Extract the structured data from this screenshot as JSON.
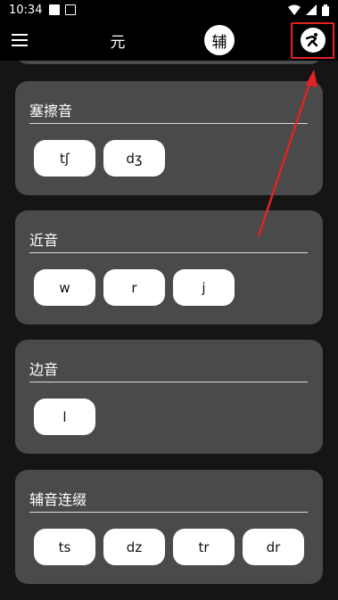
{
  "status": {
    "time": "10:34"
  },
  "toolbar": {
    "tab_vowel": "元",
    "tab_consonant": "辅"
  },
  "sections": [
    {
      "title": "塞擦音",
      "items": [
        "tʃ",
        "dʒ"
      ]
    },
    {
      "title": "近音",
      "items": [
        "w",
        "r",
        "j"
      ]
    },
    {
      "title": "边音",
      "items": [
        "l"
      ]
    },
    {
      "title": "辅音连缀",
      "items": [
        "ts",
        "dz",
        "tr",
        "dr"
      ]
    }
  ],
  "colors": {
    "background": "#151515",
    "card": "#4a4a4c",
    "chip": "#ffffff",
    "highlight": "#e52222"
  }
}
